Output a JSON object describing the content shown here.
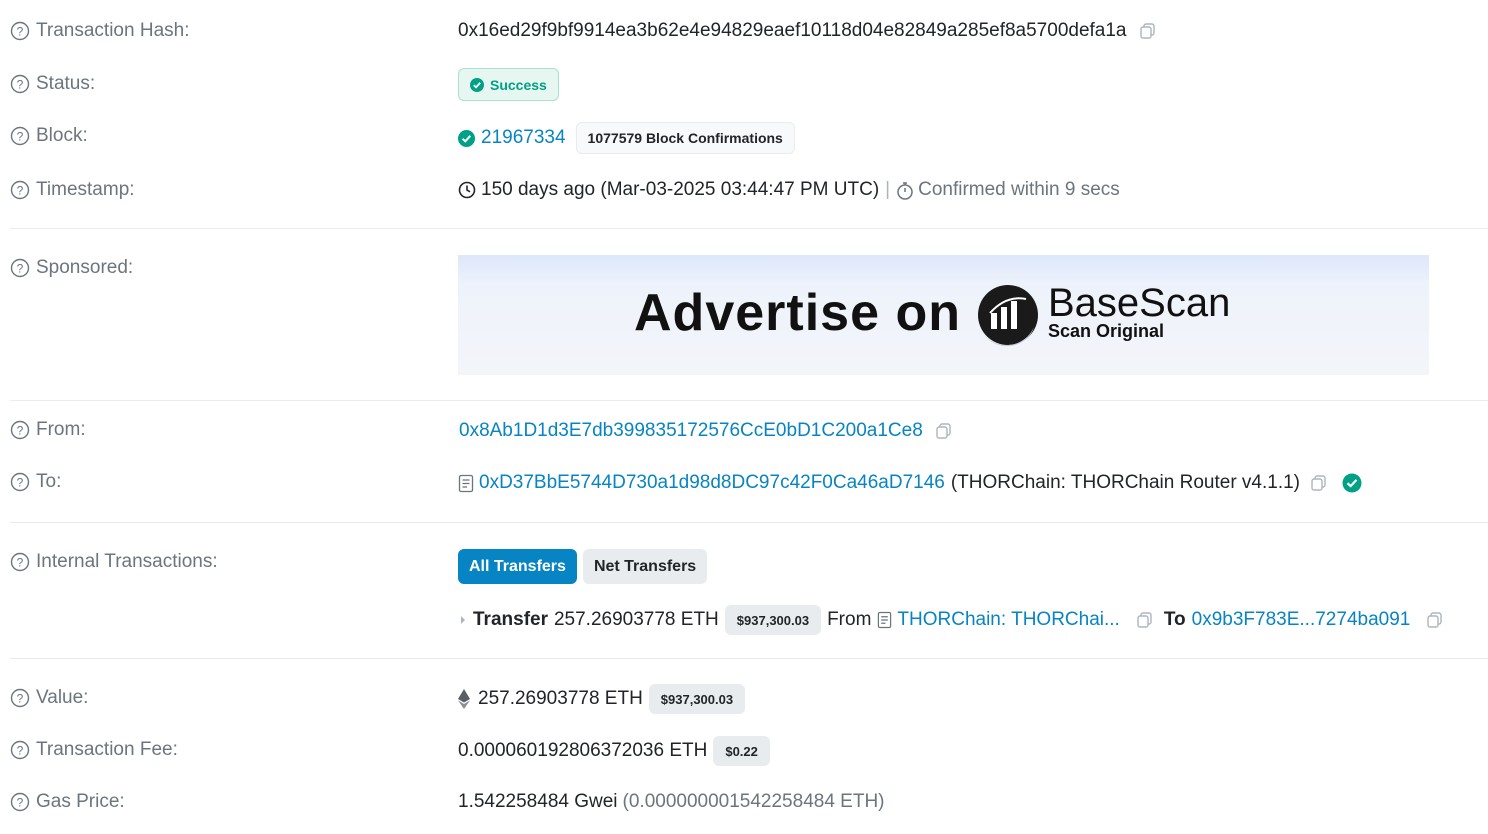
{
  "rows": {
    "tx_hash": {
      "label": "Transaction Hash:",
      "value": "0x16ed29f9bf9914ea3b62e4e94829eaef10118d04e82849a285ef8a5700defa1a"
    },
    "status": {
      "label": "Status:",
      "value": "Success"
    },
    "block": {
      "label": "Block:",
      "number": "21967334",
      "confirmations": "1077579 Block Confirmations"
    },
    "timestamp": {
      "label": "Timestamp:",
      "value": "150 days ago (Mar-03-2025 03:44:47 PM UTC)",
      "separator": "|",
      "confirmed": "Confirmed within 9 secs"
    },
    "sponsored": {
      "label": "Sponsored:",
      "ad_text": "Advertise on",
      "ad_brand": "BaseScan",
      "ad_sub": "Scan Original"
    },
    "from": {
      "label": "From:",
      "address": "0x8Ab1D1d3E7db399835172576CcE0bD1C200a1Ce8"
    },
    "to": {
      "label": "To:",
      "address": "0xD37BbE5744D730a1d98d8DC97c42F0Ca46aD7146",
      "name": "(THORChain: THORChain Router v4.1.1)"
    },
    "internal": {
      "label": "Internal Transactions:",
      "tab_all": "All Transfers",
      "tab_net": "Net Transfers",
      "transfer_label": "Transfer",
      "transfer_amount": "257.26903778 ETH",
      "transfer_usd": "$937,300.03",
      "from_label": "From",
      "from_name": "THORChain: THORChai...",
      "to_label": "To",
      "to_address": "0x9b3F783E...7274ba091"
    },
    "value": {
      "label": "Value:",
      "amount": "257.26903778 ETH",
      "usd": "$937,300.03"
    },
    "fee": {
      "label": "Transaction Fee:",
      "amount": "0.000060192806372036 ETH",
      "usd": "$0.22"
    },
    "gas": {
      "label": "Gas Price:",
      "gwei": "1.542258484 Gwei",
      "eth": "(0.000000001542258484 ETH)"
    }
  },
  "colors": {
    "link": "#0784c3",
    "success": "#00a186",
    "muted": "#6c757d",
    "primary_button": "#0784c3"
  },
  "icons": [
    "question-circle-icon",
    "copy-icon",
    "check-circle-icon",
    "clock-icon",
    "stopwatch-icon",
    "contract-file-icon",
    "eth-diamond-icon",
    "caret-right-icon"
  ]
}
